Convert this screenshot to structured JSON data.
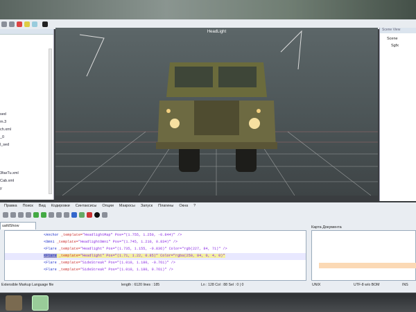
{
  "viewport": {
    "title": "HeadLight"
  },
  "left_panel": {
    "items": [
      "sed",
      "m.3",
      "ch.xml",
      "_0",
      "l_sed",
      "3faxTu.xml",
      "Cab.xml",
      "y"
    ]
  },
  "right_panel": {
    "title": "Scene View",
    "items": [
      "Scene",
      "Sgfx"
    ]
  },
  "editor": {
    "menu": [
      "Правка",
      "Поиск",
      "Вид",
      "Кодировки",
      "Синтаксисы",
      "Опции",
      "Макросы",
      "Запуск",
      "Плагины",
      "Окна",
      "?"
    ],
    "tab": "uafdShow",
    "doc_map_title": "Карта Документа",
    "lines": [
      {
        "tag": "<Anchor",
        "attr": " _template=",
        "val": "\"HeadlightMap\" Pos=\"(1.755, 1.250, -0.844)\" />"
      },
      {
        "tag": "<Omni",
        "attr": " _template=",
        "val": "\"HeadlightOmni\" Pos=\"(1.745, 1.210, 0.834)\" />"
      },
      {
        "tag": "<Flare",
        "attr": " _template=",
        "val": "\"Headlight\" Pos=\"(1.735, 1.155, -0.836)\" Color=\"rgb(227, 84, 71)\" />"
      },
      {
        "tag": "<Flare",
        "attr": " _template=",
        "val": "\"Headlight\" Pos=\"(1.71, 1.22, 0.85)\" Color=\"rgba(250, 84, 0, 4, 0)\""
      },
      {
        "tag": "<Flare",
        "attr": " _template=",
        "val": "\"SideStreak\" Pos=\"(1.010, 1.180, -0.761)\" />"
      },
      {
        "tag": "<Flare",
        "attr": " _template=",
        "val": "\"SideStreak\" Pos=\"(1.010, 1.180, 0.761)\" />"
      }
    ],
    "status": {
      "type": "Extensible Markup Language file",
      "length": "length : 6120   lines : 185",
      "pos": "Ln : 128   Col : 88   Sel : 0 | 0",
      "eol": "UNIX",
      "encoding": "UTF-8 w/o BOM",
      "mode": "INS"
    }
  }
}
